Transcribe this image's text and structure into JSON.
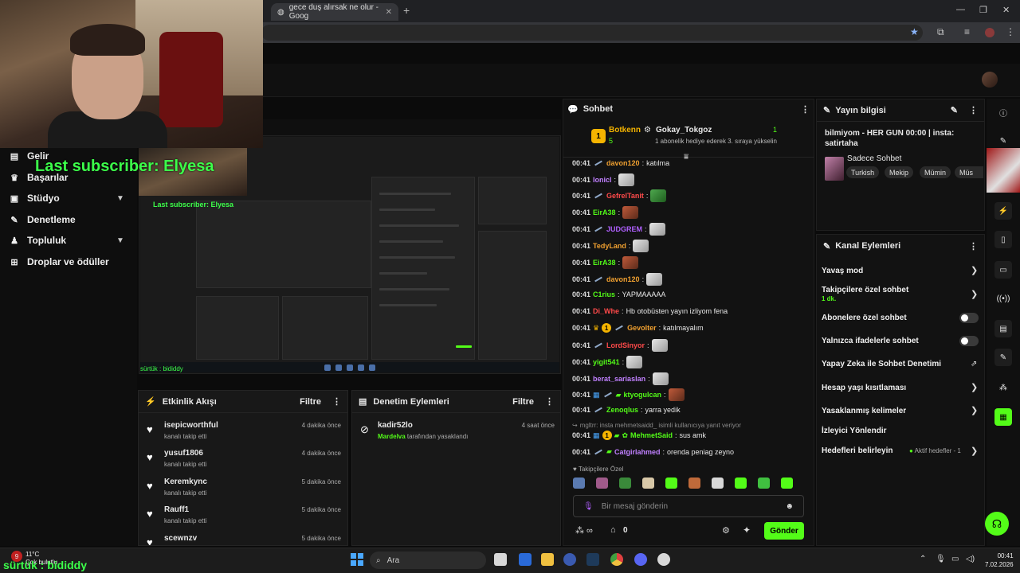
{
  "browser": {
    "tab_title": "gece duş alırsak ne olur - Goog",
    "new_tab": "+"
  },
  "sidebar": {
    "items": [
      {
        "label": "Gelir",
        "icon": "chart-icon"
      },
      {
        "label": "Başarılar",
        "icon": "trophy-icon"
      },
      {
        "label": "Stüdyo",
        "icon": "studio-icon"
      },
      {
        "label": "Denetleme",
        "icon": "wrench-icon"
      },
      {
        "label": "Topluluk",
        "icon": "people-icon"
      },
      {
        "label": "Droplar ve ödüller",
        "icon": "gift-icon"
      }
    ]
  },
  "overlay": {
    "last_subscriber": "Last subscriber: Elyesa",
    "preview_last_subscriber": "Last subscriber: Elyesa",
    "name_tag": "sürtük : bididdy",
    "preview_name_tag": "sürtük : bididdy"
  },
  "activity": {
    "title": "Etkinlik Akışı",
    "filter": "Filtre",
    "rows": [
      {
        "name": "isepicworthful",
        "sub": "kanalı takip etti",
        "time": "4 dakika önce"
      },
      {
        "name": "yusuf1806",
        "sub": "kanalı takip etti",
        "time": "4 dakika önce"
      },
      {
        "name": "Keremkync",
        "sub": "kanalı takip etti",
        "time": "5 dakika önce"
      },
      {
        "name": "Rauff1",
        "sub": "kanalı takip etti",
        "time": "5 dakika önce"
      },
      {
        "name": "scewnzv",
        "sub": "",
        "time": "5 dakika önce"
      }
    ]
  },
  "moderation": {
    "title": "Denetim Eylemleri",
    "filter": "Filtre",
    "row": {
      "name": "kadir52lo",
      "by": "Mardelva",
      "suffix": " tarafından yasaklandı",
      "time": "4 saat önce"
    }
  },
  "chat": {
    "title": "Sohbet",
    "leader1": {
      "name": "Botkenn",
      "rank": "1",
      "count": "5"
    },
    "leader2": {
      "name": "Gokay_Tokgoz",
      "count": "1",
      "desc": "1 abonelik hediye ederek 3. sıraya yükselin"
    },
    "messages": [
      {
        "time": "00:41",
        "user": "davon120",
        "color": "#f0a030",
        "text": "katılma"
      },
      {
        "time": "00:41",
        "user": "lonicl",
        "color": "#c080ff",
        "text": ""
      },
      {
        "time": "00:41",
        "user": "GefrelTanit",
        "color": "#ff4a4a",
        "text": ""
      },
      {
        "time": "00:41",
        "user": "EirA38",
        "color": "#53fc18",
        "text": ""
      },
      {
        "time": "00:41",
        "user": "JUDGREM",
        "color": "#b060ff",
        "text": ""
      },
      {
        "time": "00:41",
        "user": "TedyLand",
        "color": "#f0a030",
        "text": ""
      },
      {
        "time": "00:41",
        "user": "EirA38",
        "color": "#53fc18",
        "text": ""
      },
      {
        "time": "00:41",
        "user": "davon120",
        "color": "#f0a030",
        "text": ""
      },
      {
        "time": "00:41",
        "user": "C1rius",
        "color": "#53fc18",
        "text": "YAPMAAAAA"
      },
      {
        "time": "00:41",
        "user": "Di_Whe",
        "color": "#ff4a4a",
        "text": "Hb otobüsten yayın izliyom fena"
      },
      {
        "time": "00:41",
        "user": "Gevolter",
        "color": "#f0a030",
        "text": "katılmayalım"
      },
      {
        "time": "00:41",
        "user": "LordSinyor",
        "color": "#ff4a4a",
        "text": ""
      },
      {
        "time": "00:41",
        "user": "yigit541",
        "color": "#53fc18",
        "text": ""
      },
      {
        "time": "00:41",
        "user": "berat_sariaslan",
        "color": "#c080ff",
        "text": ""
      },
      {
        "time": "00:41",
        "user": "ktyogulcan",
        "color": "#53fc18",
        "text": ""
      },
      {
        "time": "00:41",
        "user": "Zenoqlus",
        "color": "#53fc18",
        "text": "yarra yedik"
      },
      {
        "time": "",
        "user": "",
        "color": "#8a8a8a",
        "text": "mgltrr: insta mehmetsaidd_ isimli kullanıcıya yanıt veriyor"
      },
      {
        "time": "00:41",
        "user": "MehmetSaid",
        "color": "#53fc18",
        "text": "sus amk"
      },
      {
        "time": "00:41",
        "user": "Catgirlahmed",
        "color": "#c080ff",
        "text": "orenda peniag zeyno"
      }
    ],
    "followers_only": "Takipçilere Özel",
    "input_placeholder": "Bir mesaj gönderin",
    "send": "Gönder",
    "viewer_count": "0"
  },
  "stream_info": {
    "title": "Yayın bilgisi",
    "stream_title": "bilmiyom - HER GUN 00:00 | insta: satirtaha",
    "category": "Sadece Sohbet",
    "tags": [
      "Turkish",
      "Mekip",
      "Mümin",
      "Müs"
    ]
  },
  "channel_actions": {
    "title": "Kanal Eylemleri",
    "items": [
      {
        "label": "Yavaş mod",
        "type": "chevron"
      },
      {
        "label": "Takipçilere özel sohbet",
        "sub": "1 dk.",
        "type": "chevron"
      },
      {
        "label": "Abonelere özel sohbet",
        "type": "toggle"
      },
      {
        "label": "Yalnızca ifadelerle sohbet",
        "type": "toggle"
      },
      {
        "label": "Yapay Zeka ile Sohbet Denetimi",
        "type": "link"
      },
      {
        "label": "Hesap yaşı kısıtlaması",
        "type": "chevron"
      },
      {
        "label": "Yasaklanmış kelimeler",
        "type": "chevron"
      },
      {
        "label": "İzleyici Yönlendir",
        "type": "none"
      },
      {
        "label": "Hedefleri belirleyin",
        "status": "Aktif hedefler - 1",
        "type": "chevron"
      }
    ]
  },
  "taskbar": {
    "search": "Ara",
    "weather": "11°C",
    "weather_sub": "Çok bulutlu",
    "time": "00:41",
    "date": "7.02.2026"
  },
  "colors": {
    "accent": "#53fc18",
    "gold": "#f5b400"
  }
}
